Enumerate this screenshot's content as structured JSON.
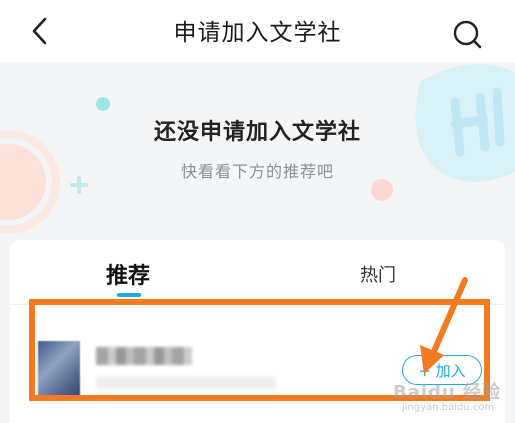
{
  "header": {
    "title": "申请加入文学社"
  },
  "empty_state": {
    "title": "还没申请加入文学社",
    "subtitle": "快看看下方的推荐吧"
  },
  "tabs": [
    {
      "label": "推荐",
      "active": true
    },
    {
      "label": "热门",
      "active": false
    }
  ],
  "recommendation": {
    "join_label": "+ 加入"
  },
  "watermark": {
    "text": "Baidu 经验",
    "url": "jingyan.baidu.com"
  },
  "colors": {
    "accent": "#1fa8e8",
    "annotation": "#f47a1f"
  }
}
